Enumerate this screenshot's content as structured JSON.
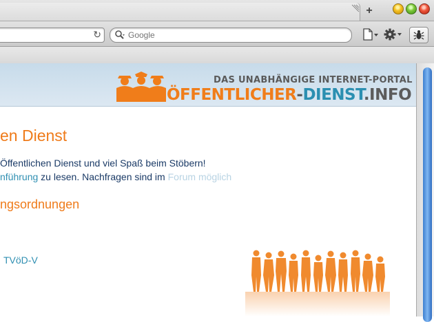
{
  "browser": {
    "new_tab_label": "+",
    "search": {
      "placeholder": "Google",
      "value": ""
    },
    "icons": [
      "tab-resize-icon",
      "new-tab-icon",
      "reload-icon",
      "search-icon",
      "page-menu-icon",
      "gear-icon",
      "bug-icon"
    ]
  },
  "header": {
    "tagline": "DAS UNABHÄNGIGE INTERNET-PORTAL",
    "brand_part1": "ÖFFENTLICHER",
    "brand_sep": "-",
    "brand_part2": "DIENST",
    "brand_part3": ".INFO",
    "colors": {
      "orange": "#f07d1a",
      "teal": "#2b8fb1",
      "grey": "#5c5c5c"
    }
  },
  "main": {
    "heading": "en Dienst",
    "para1": "Öffentlichen Dienst und viel Spaß beim Stöbern!",
    "para2_link": "nführung",
    "para2_text": " zu lesen. Nachfragen sind im ",
    "para2_faded": "Forum möglich",
    "subheading": "ngsordnungen",
    "link_tvod": "TVöD-V"
  }
}
